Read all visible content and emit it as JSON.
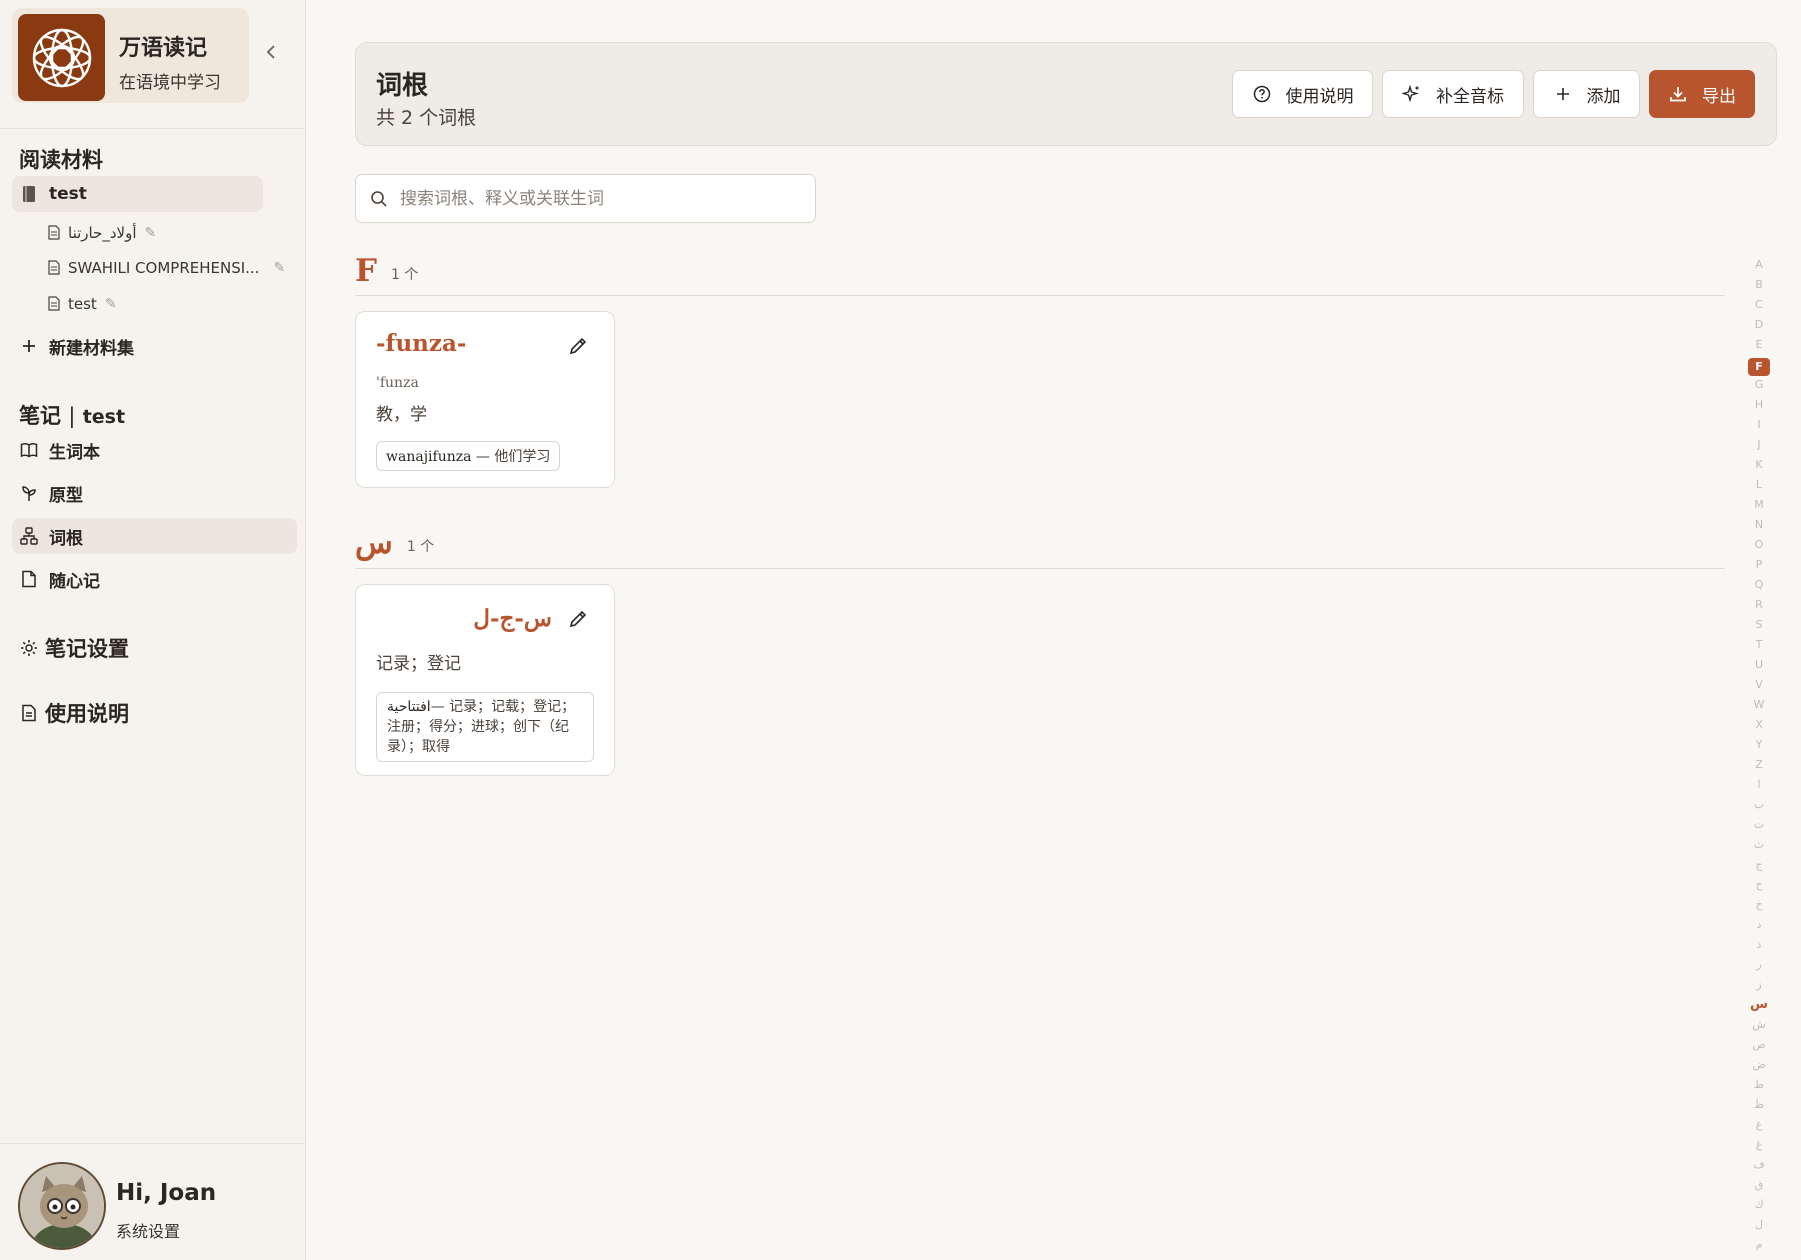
{
  "brand": {
    "title": "万语读记",
    "subtitle": "在语境中学习"
  },
  "sidebar": {
    "reading_title": "阅读材料",
    "collection": "test",
    "materials": [
      {
        "label": "أولاد_حارتنا"
      },
      {
        "label": "SWAHILI COMPREHENSI..."
      },
      {
        "label": "test"
      }
    ],
    "new_collection": "新建材料集",
    "notes_title": "笔记",
    "notes_sep": "|",
    "notes_context": "test",
    "notes_items": [
      {
        "label": "生词本",
        "icon": "book-icon"
      },
      {
        "label": "原型",
        "icon": "sprout-icon"
      },
      {
        "label": "词根",
        "icon": "tree-icon",
        "active": true
      },
      {
        "label": "随心记",
        "icon": "note-icon"
      }
    ],
    "note_settings": "笔记设置",
    "help": "使用说明"
  },
  "user": {
    "greeting": "Hi, Joan",
    "settings": "系统设置"
  },
  "header": {
    "title": "词根",
    "count": "共 2 个词根",
    "buttons": {
      "help": "使用说明",
      "fill_ipa": "补全音标",
      "add": "添加",
      "export": "导出"
    }
  },
  "search": {
    "placeholder": "搜索词根、释义或关联生词",
    "value": ""
  },
  "groups": [
    {
      "letter": "F",
      "count": "1 个",
      "card": {
        "root": "-funza-",
        "ipa": "'funza",
        "meaning": "教，学",
        "chip_word": "wanajifunza",
        "chip_sep": " — ",
        "chip_meaning": "他们学习"
      }
    },
    {
      "letter": "س",
      "count": "1 个",
      "card": {
        "root": "س-ج-ل",
        "meaning": "记录；登记",
        "chip_word": "افتتاحية",
        "chip_sep": "— ",
        "chip_meaning": "记录；记载；登记；注册；得分；进球；创下（纪录）；取得"
      }
    }
  ],
  "alphabet": [
    "A",
    "B",
    "C",
    "D",
    "E",
    "F",
    "G",
    "H",
    "I",
    "J",
    "K",
    "L",
    "M",
    "N",
    "O",
    "P",
    "Q",
    "R",
    "S",
    "T",
    "U",
    "V",
    "W",
    "X",
    "Y",
    "Z",
    "ا",
    "ب",
    "ت",
    "ث",
    "ج",
    "ح",
    "خ",
    "د",
    "ذ",
    "ر",
    "ز",
    "س",
    "ش",
    "ص",
    "ض",
    "ط",
    "ظ",
    "ع",
    "غ",
    "ف",
    "ق",
    "ك",
    "ل",
    "م"
  ],
  "alphabet_active": [
    "F",
    "س"
  ],
  "colors": {
    "accent": "#b8552f",
    "logo_bg": "#8a3a10",
    "bg": "#f9f7f4"
  }
}
